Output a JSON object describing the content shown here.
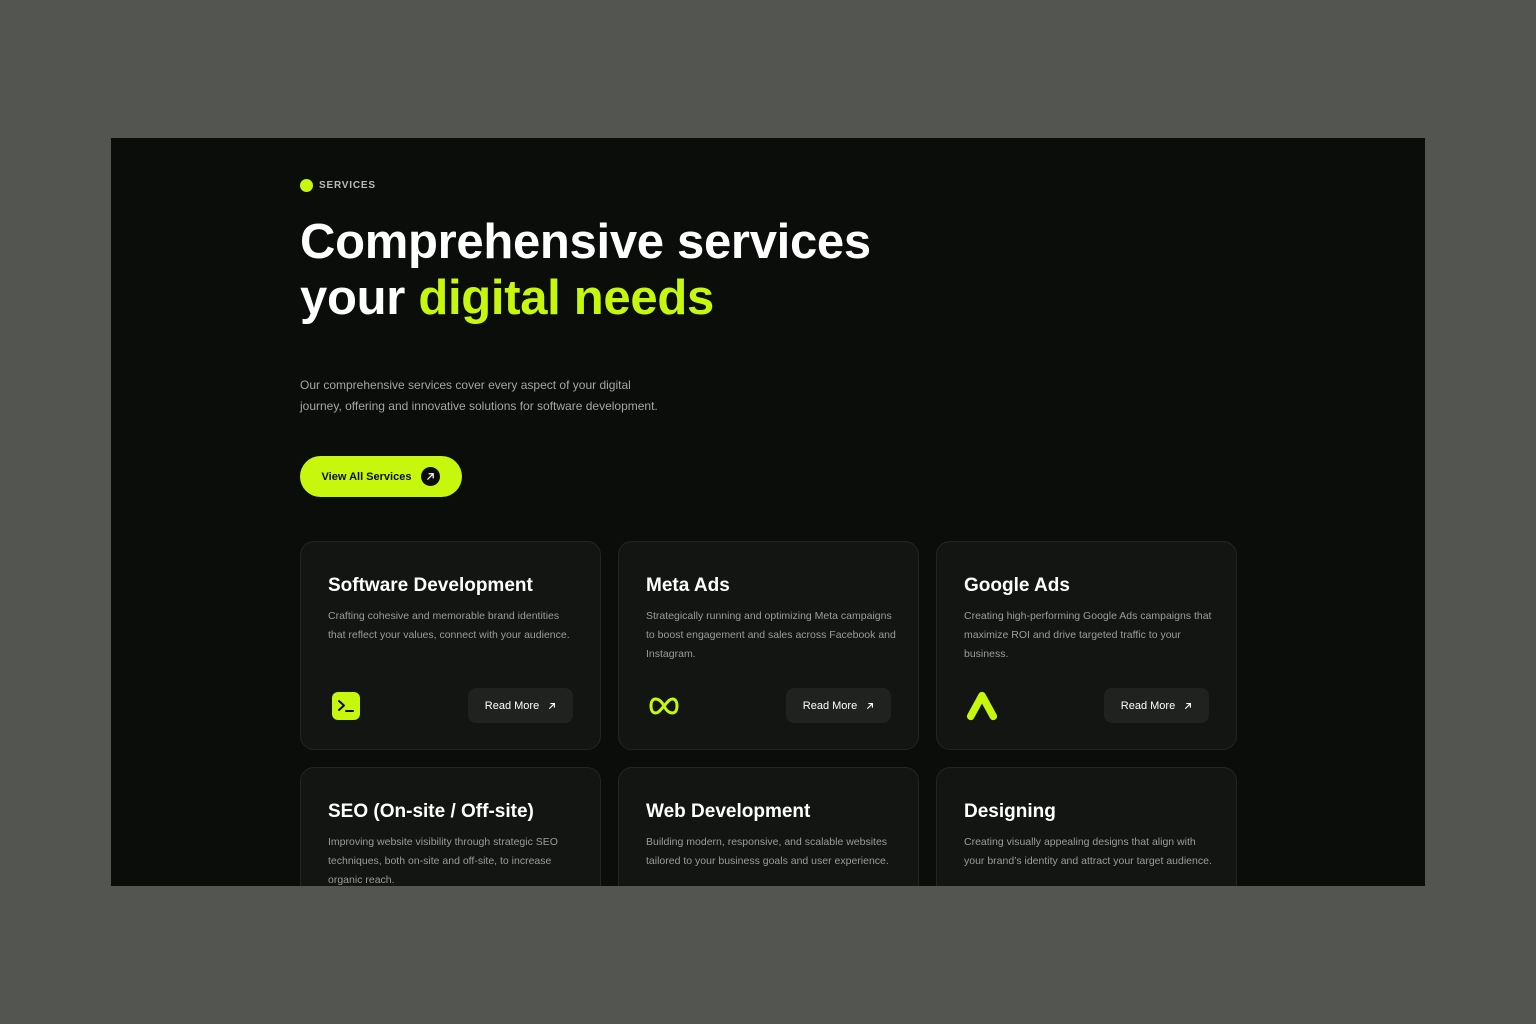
{
  "section": {
    "eyebrow": "SERVICES",
    "headline_line1": "Comprehensive services",
    "headline_line2_plain": "your",
    "headline_line2_accent": "digital needs",
    "intro": "Our comprehensive services cover every aspect of your digital journey, offering and innovative solutions for software development.",
    "cta_label": "View All Services",
    "cta_icon": "arrow-up-right-icon"
  },
  "theme": {
    "accent": "#c6f70d",
    "background": "#0b0d0b",
    "card_background": "#121512",
    "outer_background": "#535650"
  },
  "services": [
    {
      "title": "Software Development",
      "description": "Crafting cohesive and memorable brand identities that reflect your values, connect with your audience.",
      "icon": "terminal-icon",
      "button_label": "Read More"
    },
    {
      "title": "Meta Ads",
      "description": "Strategically running and optimizing Meta campaigns to boost engagement and sales across Facebook and Instagram.",
      "icon": "meta-infinity-icon",
      "button_label": "Read More"
    },
    {
      "title": "Google Ads",
      "description": "Creating high-performing Google Ads campaigns that maximize ROI and drive targeted traffic to your business.",
      "icon": "google-ads-icon",
      "button_label": "Read More"
    },
    {
      "title": "SEO (On-site / Off-site)",
      "description": "Improving website visibility through strategic SEO techniques, both on-site and off-site, to increase organic reach.",
      "icon": "",
      "button_label": ""
    },
    {
      "title": "Web Development",
      "description": "Building modern, responsive, and scalable websites tailored to your business goals and user experience.",
      "icon": "",
      "button_label": ""
    },
    {
      "title": "Designing",
      "description": "Creating visually appealing designs that align with your brand’s identity and attract your target audience.",
      "icon": "",
      "button_label": ""
    }
  ]
}
